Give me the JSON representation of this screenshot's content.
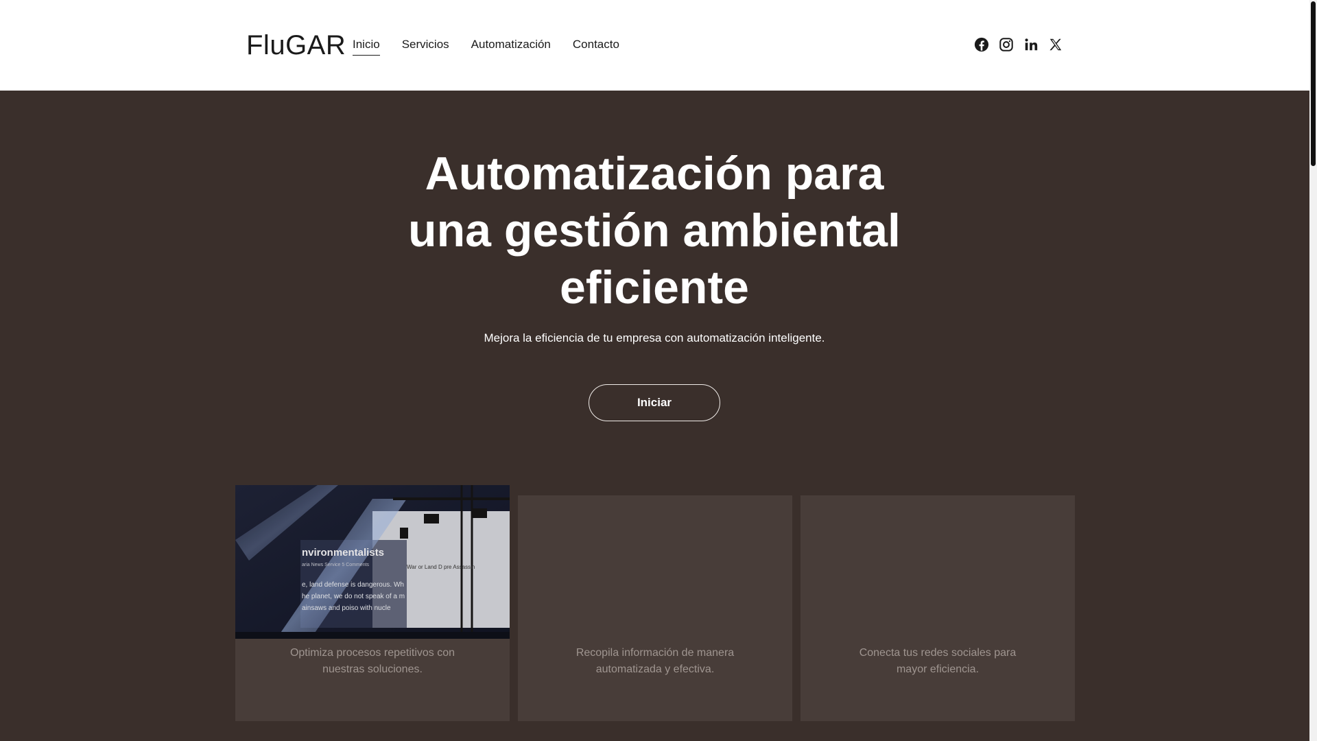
{
  "header": {
    "logo": "FluGAR",
    "nav": [
      {
        "label": "Inicio",
        "active": true
      },
      {
        "label": "Servicios"
      },
      {
        "label": "Automatización"
      },
      {
        "label": "Contacto"
      }
    ],
    "socials": [
      "facebook-icon",
      "instagram-icon",
      "linkedin-icon",
      "x-icon"
    ]
  },
  "hero": {
    "title_lines": [
      "Automatización para",
      "una gestión ambiental",
      "eficiente"
    ],
    "subtitle": "Mejora la eficiencia de tu empresa con automatización inteligente.",
    "cta": "Iniciar"
  },
  "cards": [
    {
      "lines": [
        "Optimiza procesos repetitivos con",
        "nuestras soluciones."
      ],
      "image_text": {
        "heading": "nvironmentalists",
        "meta": "aria News Service   5 Comments",
        "lines": [
          "e, land defense is dangerous. Wh",
          "he planet, we do not speak of a m",
          "ainsaws and poiso     with nucle"
        ],
        "side": "War or Land D    pre Assassin"
      }
    },
    {
      "lines": [
        "Recopila información de manera",
        "automatizada y efectiva."
      ]
    },
    {
      "lines": [
        "Conecta tus redes sociales para",
        "mayor eficiencia."
      ]
    }
  ],
  "colors": {
    "hero_bg": "#3a2f2b",
    "card_bg": "#4a3f3b",
    "card_text": "#a89e99",
    "header_bg": "#ffffff"
  }
}
